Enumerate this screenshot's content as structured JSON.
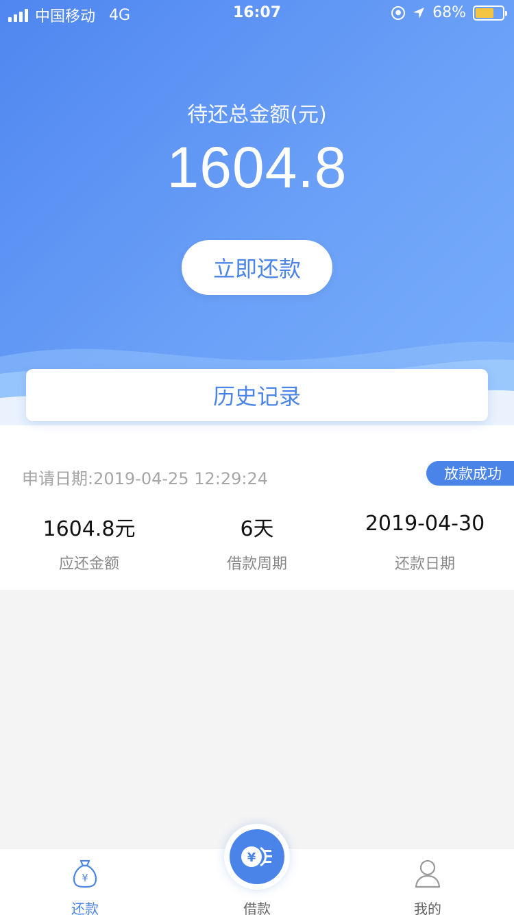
{
  "status_bar": {
    "carrier": "中国移动",
    "network": "4G",
    "time": "16:07",
    "battery": "68%",
    "battery_level": 0.68
  },
  "summary": {
    "total_label": "待还总金额(元)",
    "total_amount": "1604.8",
    "repay_button": "立即还款"
  },
  "history": {
    "title": "历史记录"
  },
  "record": {
    "apply_date": "申请日期:2019-04-25 12:29:24",
    "status": "放款成功",
    "stats": [
      {
        "value": "1604.8元",
        "label": "应还金额"
      },
      {
        "value": "6天",
        "label": "借款周期"
      },
      {
        "value": "2019-04-30",
        "label": "还款日期"
      }
    ]
  },
  "tabs": [
    {
      "label": "还款",
      "icon": "money-bag-icon",
      "active": true
    },
    {
      "label": "借款",
      "icon": "yen-coin-icon",
      "active": false
    },
    {
      "label": "我的",
      "icon": "user-icon",
      "active": false
    }
  ],
  "colors": {
    "accent": "#4a84e8",
    "gradient_start": "#4f86f0",
    "gradient_end": "#79aefb"
  }
}
